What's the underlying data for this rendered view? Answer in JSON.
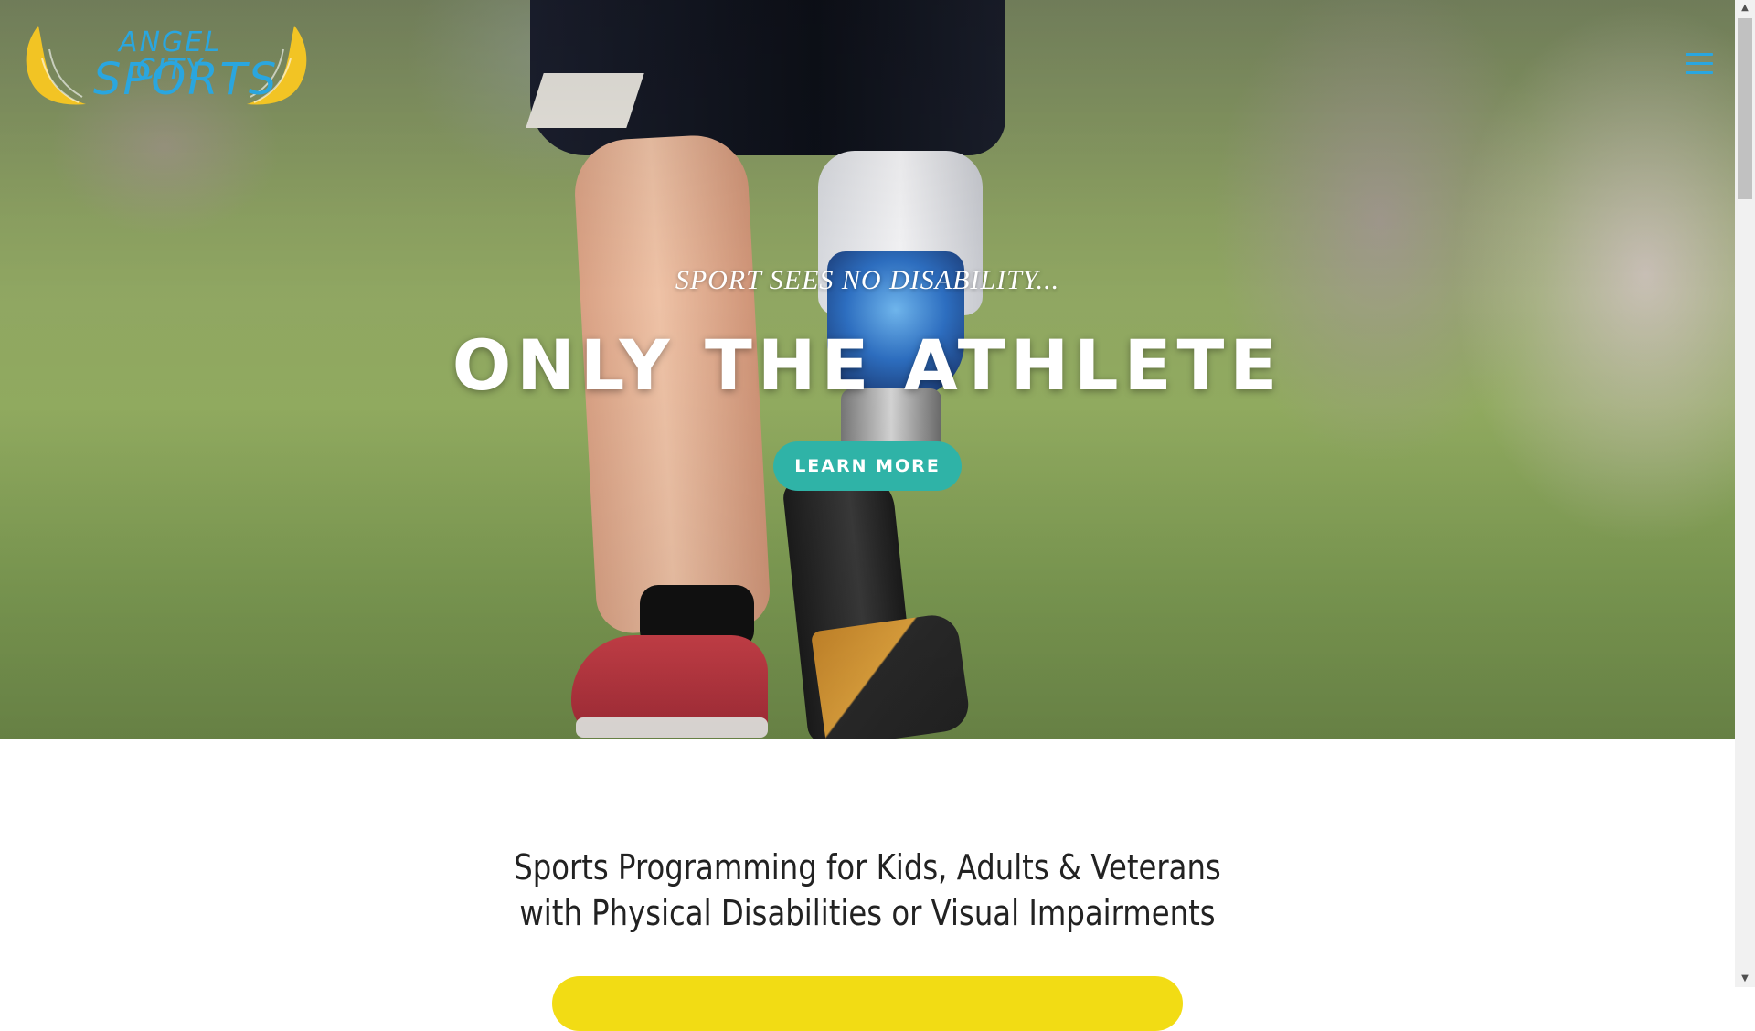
{
  "header": {
    "logo_line1": "ANGEL CITY",
    "logo_line2": "SPORTS",
    "menu_icon": "hamburger-icon"
  },
  "hero": {
    "tagline": "SPORT SEES NO DISABILITY...",
    "headline": "ONLY THE ATHLETE",
    "cta_label": "LEARN MORE"
  },
  "content": {
    "program_title_line1": "Sports Programming for Kids, Adults & Veterans",
    "program_title_line2": "with Physical Disabilities or Visual Impairments"
  },
  "colors": {
    "accent_blue": "#2aa6df",
    "wing_gold": "#f2c424",
    "cta_teal": "#2fb3a7",
    "cta_yellow": "#f2dc14"
  }
}
